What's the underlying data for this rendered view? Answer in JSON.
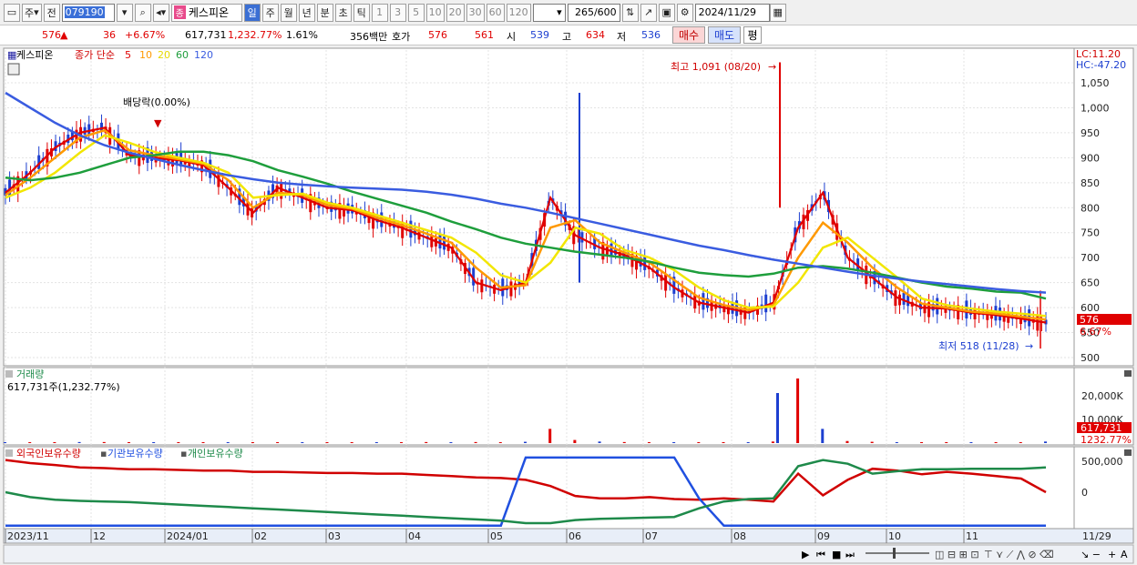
{
  "toolbar": {
    "period_labels": [
      "주",
      "전"
    ],
    "code": "079190",
    "stock_tag": "종",
    "stock_name": "케스피온",
    "interval_tabs": [
      "일",
      "주",
      "월",
      "년",
      "분",
      "초",
      "틱"
    ],
    "interval_selected": "일",
    "tick_numbers": [
      "1",
      "3",
      "5",
      "10",
      "20",
      "30",
      "60",
      "120"
    ],
    "count": "265",
    "count_total": "/600",
    "date": "2024/11/29"
  },
  "quote": {
    "price": "576",
    "arrow": "▲",
    "change": "36",
    "change_pct": "+6.67%",
    "volume": "617,731",
    "volume_pct": "1,232.77%",
    "turnover_pct": "1.61%",
    "amount": "356백만",
    "bid_label": "호가",
    "ask_price": "576",
    "bid_price": "561",
    "open_label": "시",
    "open": "539",
    "high_label": "고",
    "high": "634",
    "low_label": "저",
    "low": "536",
    "buy_label": "매수",
    "sell_label": "매도",
    "avg_label": "평"
  },
  "price_panel": {
    "stock_name": "케스피온",
    "ma_title": "종가 단순",
    "ma_periods": [
      "5",
      "10",
      "20",
      "60",
      "120"
    ],
    "ma_colors": [
      "#e00000",
      "#ff9900",
      "#f2e600",
      "#1e9e3c",
      "#3a5ce0"
    ],
    "lc_label": "LC:11.20",
    "hc_label": "HC:-47.20",
    "high_annotation": "최고 1,091 (08/20)",
    "low_annotation": "최저 518 (11/28)",
    "dividend_annotation": "배당락(0.00%)",
    "last_price_tag": "576",
    "last_pct_tag": "6.67%",
    "y_ticks": [
      "1,050",
      "1,000",
      "950",
      "900",
      "850",
      "800",
      "750",
      "700",
      "650",
      "600",
      "550",
      "500"
    ]
  },
  "volume_panel": {
    "title": "거래량",
    "value_text": "617,731주(1,232.77%)",
    "y_ticks": [
      "20,000K",
      "10,000K"
    ],
    "last_tag": "617,731",
    "last_pct_tag": "1232.77%"
  },
  "holdings_panel": {
    "series_labels": [
      "외국인보유수량",
      "기관보유수량",
      "개인보유수량"
    ],
    "series_colors": [
      "#d00000",
      "#2050e0",
      "#1e8a4a"
    ],
    "y_ticks": [
      "500,000",
      "0"
    ]
  },
  "x_axis": {
    "labels": [
      "2023/11",
      "12",
      "2024/01",
      "02",
      "03",
      "04",
      "05",
      "06",
      "07",
      "08",
      "09",
      "10",
      "11"
    ],
    "end_label": "11/29"
  },
  "chart_data": {
    "type": "line",
    "title": "케스피온",
    "price_ylim": [
      480,
      1100
    ],
    "high": 1091,
    "low": 518,
    "close": 576,
    "ma_series": [
      {
        "name": "5",
        "values": [
          830,
          870,
          920,
          950,
          960,
          905,
          900,
          895,
          885,
          840,
          790,
          840,
          820,
          800,
          795,
          775,
          760,
          740,
          720,
          650,
          635,
          650,
          820,
          745,
          720,
          705,
          680,
          640,
          610,
          600,
          590,
          610,
          760,
          830,
          700,
          660,
          620,
          600,
          598,
          590,
          585,
          578,
          570
        ]
      },
      {
        "name": "10",
        "values": [
          825,
          860,
          900,
          940,
          955,
          915,
          905,
          897,
          888,
          855,
          800,
          830,
          825,
          805,
          798,
          780,
          765,
          748,
          730,
          680,
          640,
          645,
          760,
          775,
          730,
          710,
          690,
          655,
          620,
          605,
          595,
          605,
          700,
          770,
          730,
          680,
          640,
          608,
          600,
          592,
          588,
          582,
          576
        ]
      },
      {
        "name": "20",
        "values": [
          820,
          840,
          870,
          910,
          945,
          930,
          912,
          900,
          890,
          870,
          820,
          825,
          828,
          810,
          800,
          785,
          770,
          755,
          740,
          710,
          665,
          650,
          690,
          760,
          748,
          715,
          700,
          675,
          640,
          615,
          600,
          602,
          650,
          720,
          740,
          700,
          660,
          618,
          605,
          598,
          592,
          588,
          583
        ]
      },
      {
        "name": "60",
        "values": [
          860,
          855,
          860,
          870,
          885,
          900,
          905,
          912,
          912,
          905,
          893,
          875,
          862,
          848,
          832,
          818,
          804,
          790,
          772,
          757,
          740,
          728,
          720,
          712,
          706,
          700,
          692,
          680,
          670,
          665,
          662,
          668,
          680,
          683,
          678,
          670,
          660,
          650,
          642,
          638,
          632,
          630,
          618
        ]
      },
      {
        "name": "120",
        "values": [
          1030,
          1000,
          970,
          945,
          925,
          910,
          898,
          886,
          875,
          865,
          857,
          850,
          846,
          843,
          840,
          838,
          836,
          832,
          826,
          818,
          808,
          800,
          790,
          779,
          768,
          757,
          746,
          735,
          724,
          715,
          705,
          696,
          688,
          680,
          672,
          664,
          658,
          652,
          647,
          642,
          637,
          633,
          630
        ]
      }
    ],
    "volume_series": {
      "name": "거래량",
      "values": [
        0.3,
        0.3,
        0.3,
        0.4,
        0.4,
        0.3,
        0.3,
        0.3,
        0.3,
        0.3,
        0.3,
        0.3,
        0.3,
        0.3,
        0.3,
        0.3,
        0.3,
        0.4,
        0.3,
        0.4,
        0.3,
        0.5,
        5.5,
        1.2,
        0.6,
        0.4,
        0.3,
        0.3,
        0.3,
        0.3,
        0.3,
        0.6,
        25,
        5.5,
        0.8,
        0.5,
        0.3,
        0.3,
        0.3,
        0.3,
        0.3,
        0.3,
        0.6
      ]
    },
    "holdings_series": [
      {
        "name": "외국인보유수량",
        "values": [
          520,
          470,
          440,
          400,
          390,
          370,
          370,
          360,
          350,
          350,
          330,
          330,
          320,
          310,
          310,
          300,
          300,
          280,
          260,
          240,
          230,
          200,
          100,
          -60,
          -100,
          -100,
          -80,
          -110,
          -120,
          -100,
          -120,
          -150,
          300,
          -50,
          200,
          380,
          350,
          290,
          330,
          300,
          260,
          220,
          0
        ]
      },
      {
        "name": "기관보유수량",
        "values": [
          -540,
          -540,
          -540,
          -540,
          -540,
          -540,
          -540,
          -540,
          -540,
          -540,
          -540,
          -540,
          -540,
          -540,
          -540,
          -540,
          -540,
          -540,
          -540,
          -540,
          -540,
          560,
          560,
          560,
          560,
          560,
          560,
          560,
          -100,
          -540,
          -540,
          -540,
          -540,
          -540,
          -540,
          -540,
          -540,
          -540,
          -540,
          -540,
          -540,
          -540,
          -540
        ]
      },
      {
        "name": "개인보유수량",
        "values": [
          0,
          -80,
          -120,
          -140,
          -150,
          -160,
          -180,
          -200,
          -220,
          -240,
          -260,
          -280,
          -300,
          -320,
          -340,
          -360,
          -380,
          -400,
          -420,
          -440,
          -460,
          -500,
          -500,
          -450,
          -430,
          -420,
          -410,
          -400,
          -260,
          -150,
          -110,
          -100,
          420,
          520,
          460,
          300,
          340,
          370,
          370,
          380,
          380,
          380,
          400
        ]
      }
    ]
  }
}
